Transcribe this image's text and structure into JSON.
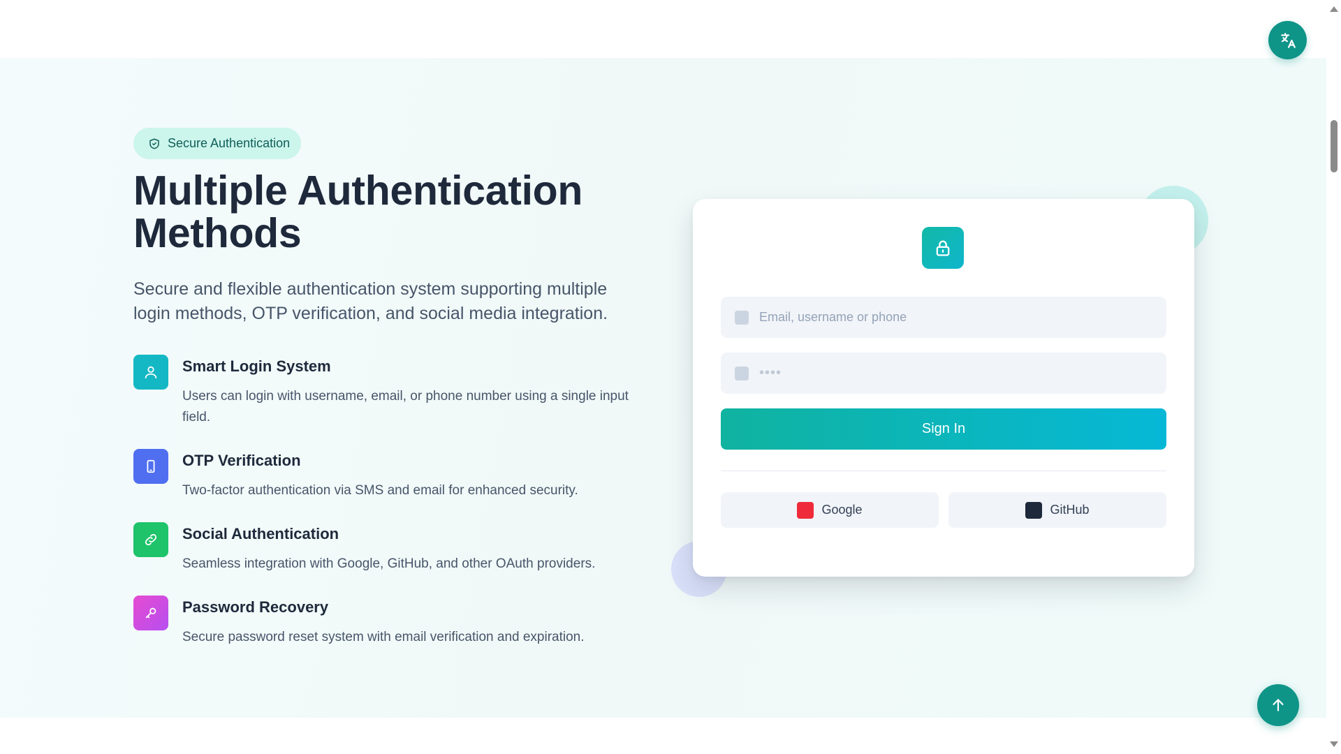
{
  "hero": {
    "badge": "Secure Authentication",
    "title": "Multiple Authentication Methods",
    "subtitle": "Secure and flexible authentication system supporting multiple login methods, OTP verification, and social media integration."
  },
  "features": [
    {
      "title": "Smart Login System",
      "description": "Users can login with username, email, or phone number using a single input field.",
      "icon": "user-icon"
    },
    {
      "title": "OTP Verification",
      "description": "Two-factor authentication via SMS and email for enhanced security.",
      "icon": "phone-icon"
    },
    {
      "title": "Social Authentication",
      "description": "Seamless integration with Google, GitHub, and other OAuth providers.",
      "icon": "link-icon"
    },
    {
      "title": "Password Recovery",
      "description": "Secure password reset system with email verification and expiration.",
      "icon": "key-icon"
    }
  ],
  "login_card": {
    "icon": "lock-icon",
    "username_placeholder": "Email, username or phone",
    "password_mask": "••••",
    "sign_in_label": "Sign In",
    "social": [
      {
        "label": "Google",
        "color": "#ef2b3b"
      },
      {
        "label": "GitHub",
        "color": "#1e293b"
      }
    ]
  },
  "controls": {
    "translate_icon": "translate-icon",
    "back_to_top_icon": "arrow-up-icon"
  },
  "colors": {
    "accent": "#0f9488",
    "badge_bg": "#ccf5ec",
    "heading": "#1e293b"
  }
}
